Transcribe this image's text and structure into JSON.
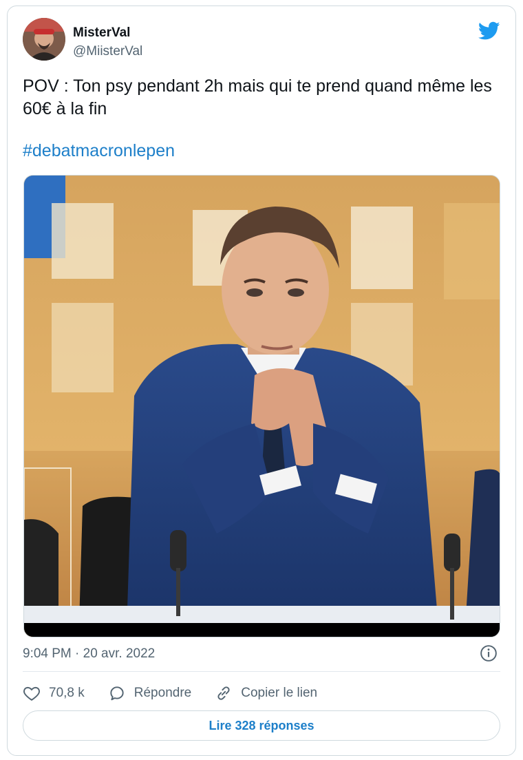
{
  "author": {
    "name": "MisterVal",
    "handle": "@MiisterVal",
    "avatar_icon": "avatar-photo"
  },
  "brand": {
    "icon": "twitter-bird-icon",
    "color": "#1d9bf0"
  },
  "tweet": {
    "text": "POV : Ton psy pendant 2h mais qui te prend quand même les 60€ à la fin",
    "hashtag": "#debatmacronlepen",
    "link_color": "#1d7fc9"
  },
  "meta": {
    "timestamp": "9:04 PM · 20 avr. 2022",
    "info_icon": "info-icon"
  },
  "actions": {
    "like_count": "70,8 k",
    "reply_label": "Répondre",
    "copy_link_label": "Copier le lien"
  },
  "replies_button": {
    "label": "Lire 328 réponses"
  }
}
